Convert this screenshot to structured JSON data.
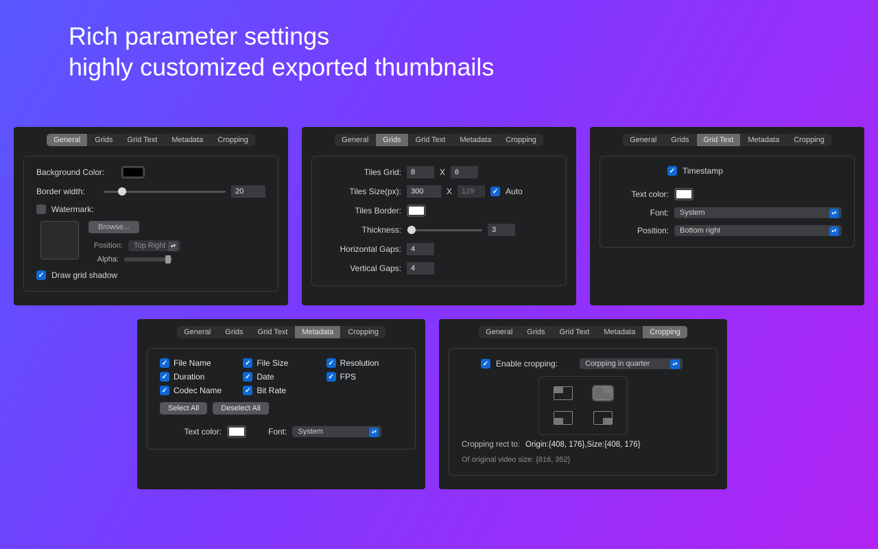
{
  "headline": {
    "line1": "Rich parameter settings",
    "line2": "highly customized exported thumbnails"
  },
  "tabs": [
    "General",
    "Grids",
    "Grid Text",
    "Metadata",
    "Cropping"
  ],
  "general": {
    "bg_color_label": "Background Color:",
    "border_width_label": "Border width:",
    "border_width_value": "20",
    "watermark_label": "Watermark:",
    "browse_label": "Browse...",
    "position_label": "Position:",
    "position_value": "Top Right",
    "alpha_label": "Alpha:",
    "draw_grid_shadow_label": "Draw grid shadow"
  },
  "grids": {
    "tiles_grid_label": "Tiles Grid:",
    "tiles_grid_x": "8",
    "tiles_grid_y": "6",
    "grid_separator": "X",
    "tiles_size_label": "Tiles Size(px):",
    "tiles_size_w": "300",
    "tiles_size_h": "129",
    "auto_label": "Auto",
    "tiles_border_label": "Tiles Border:",
    "thickness_label": "Thickness:",
    "thickness_value": "3",
    "hgap_label": "Horizontal Gaps:",
    "hgap_value": "4",
    "vgap_label": "Vertical Gaps:",
    "vgap_value": "4"
  },
  "gridtext": {
    "timestamp_label": "Timestamp",
    "text_color_label": "Text color:",
    "font_label": "Font:",
    "font_value": "System",
    "position_label": "Position:",
    "position_value": "Bottom right"
  },
  "metadata": {
    "fields": [
      "File Name",
      "File Size",
      "Resolution",
      "Duration",
      "Date",
      "FPS",
      "Codec Name",
      "Bit Rate"
    ],
    "select_all": "Select All",
    "deselect_all": "Deselect All",
    "text_color_label": "Text color:",
    "font_label": "Font:",
    "font_value": "System"
  },
  "cropping": {
    "enable_label": "Enable cropping:",
    "mode_value": "Corpping in quarter",
    "rect_label": "Cropping rect to:",
    "rect_value": "Origin:{408, 176},Size:{408, 176}",
    "original_label": "Of original video size: {816, 352}"
  }
}
